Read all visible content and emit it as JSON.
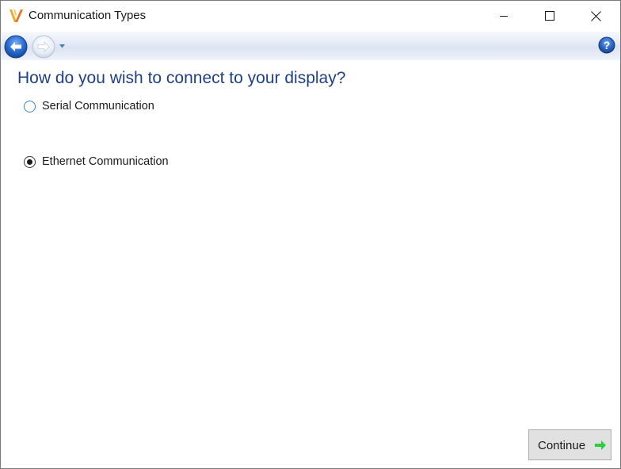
{
  "window": {
    "title": "Communication Types",
    "app_icon": "v-logo-icon",
    "controls": {
      "minimize": "minimize-icon",
      "maximize": "maximize-icon",
      "close": "close-icon"
    }
  },
  "nav": {
    "back_icon": "back-arrow-icon",
    "forward_icon": "forward-arrow-icon",
    "dropdown_icon": "chevron-down-icon",
    "help_icon": "help-icon"
  },
  "main": {
    "heading": "How do you wish to connect to your display?",
    "options": [
      {
        "label": "Serial Communication",
        "selected": false
      },
      {
        "label": "Ethernet Communication",
        "selected": true
      }
    ],
    "continue_label": "Continue",
    "continue_icon": "green-arrow-right-icon"
  },
  "colors": {
    "heading": "#1e3f8a",
    "nav_arrow_blue": "#2a6fd6",
    "continue_arrow": "#2ecc40",
    "app_icon_orange": "#f08a1c"
  }
}
